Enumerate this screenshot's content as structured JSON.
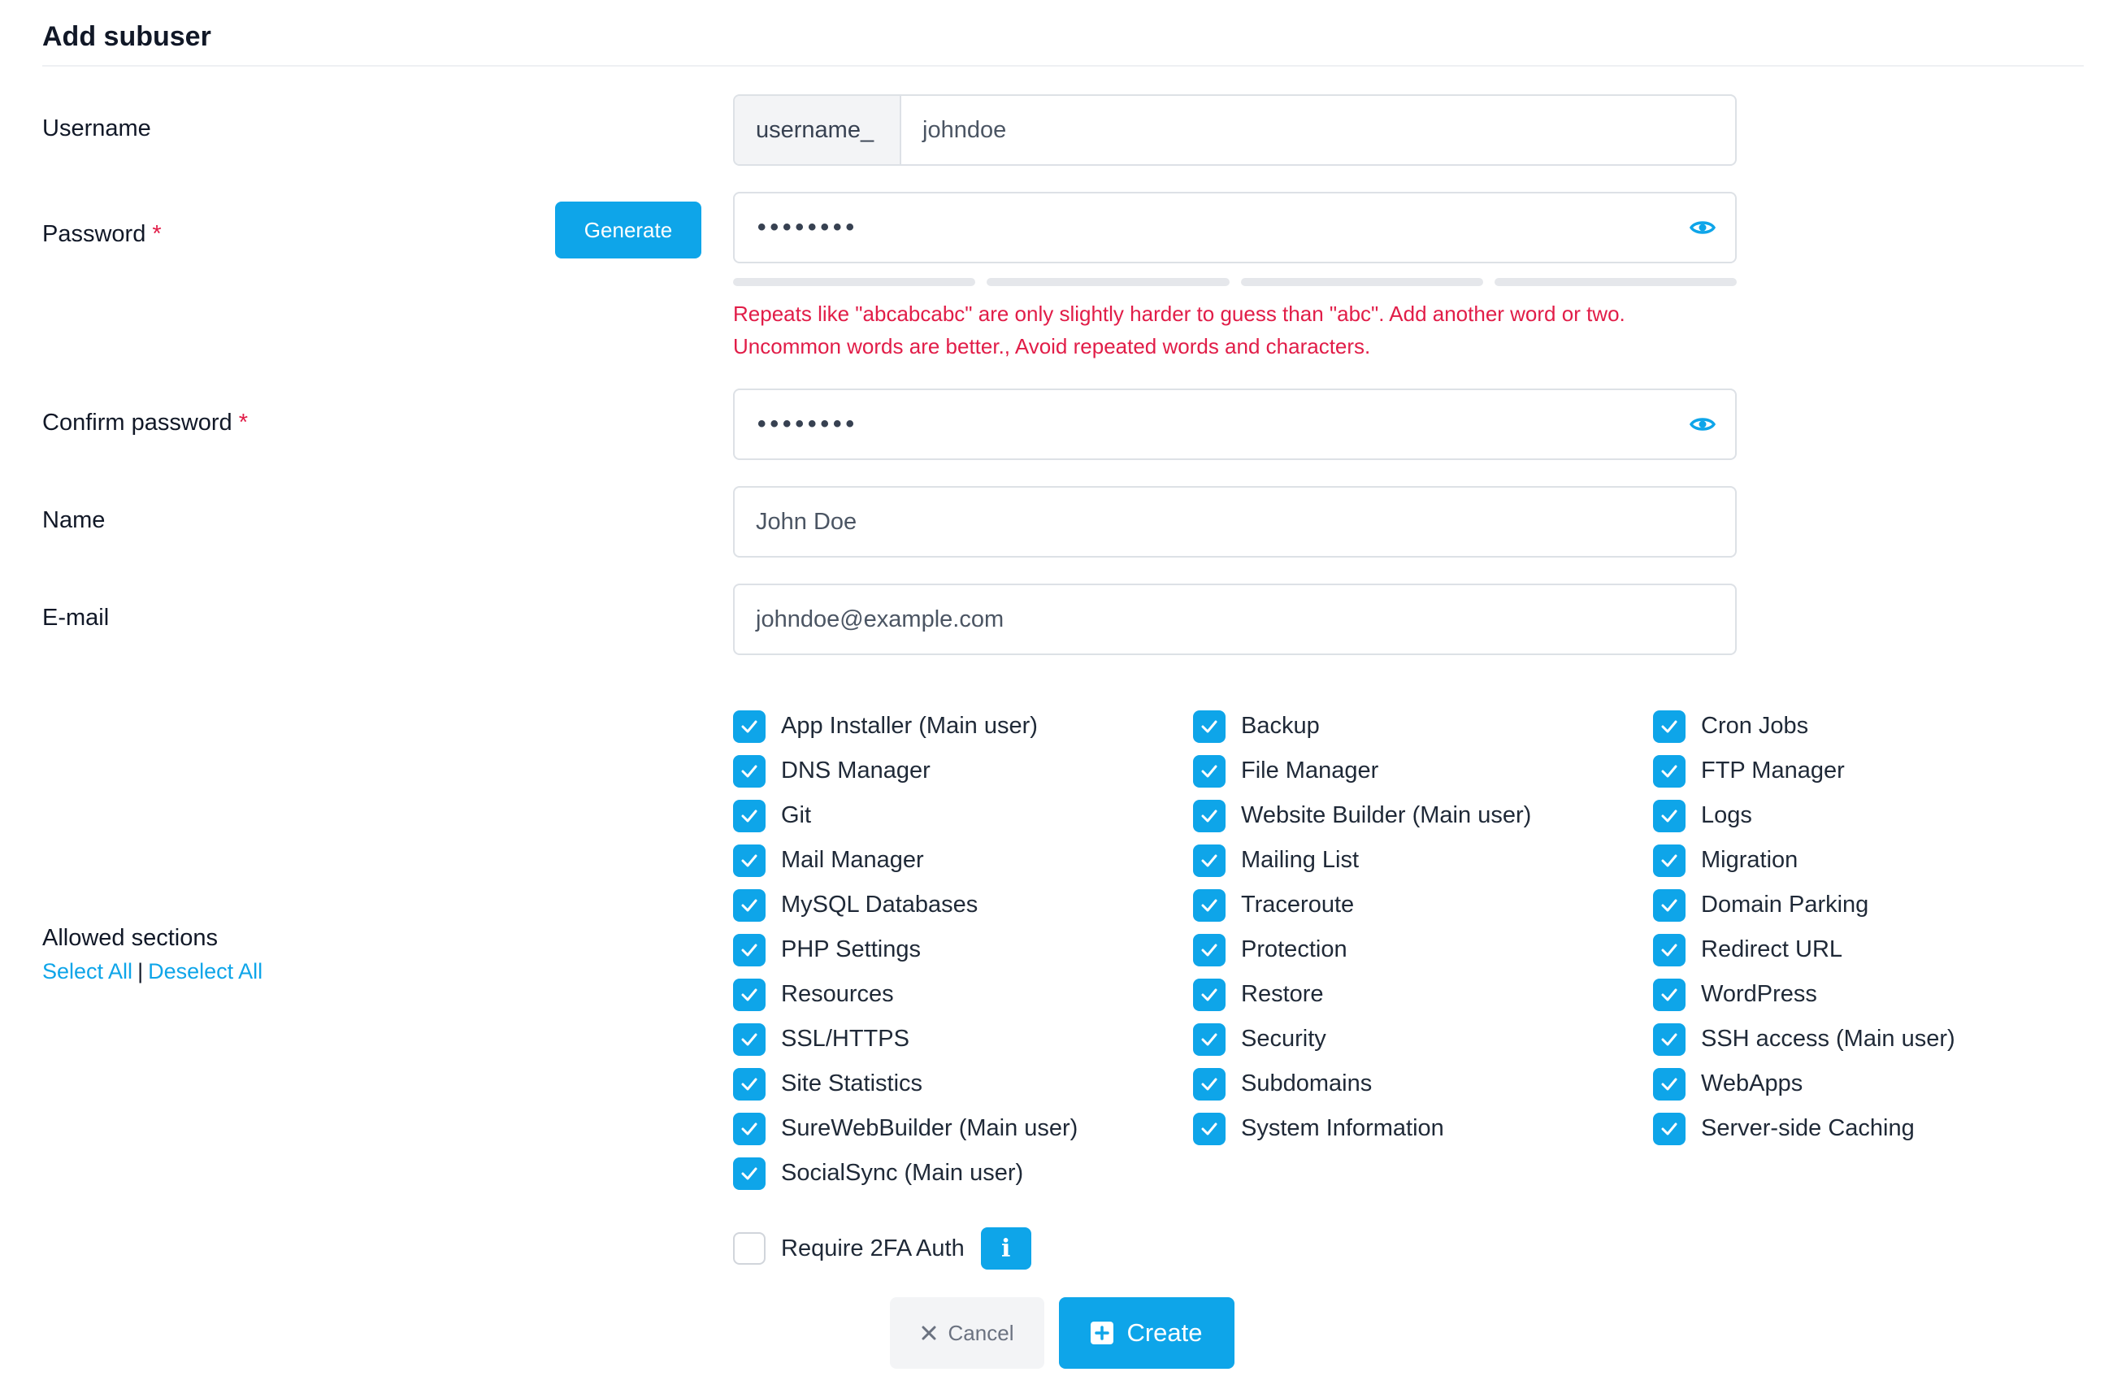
{
  "page": {
    "title": "Add subuser"
  },
  "form": {
    "username": {
      "label": "Username",
      "prefix": "username_",
      "value": "johndoe"
    },
    "password": {
      "label": "Password",
      "required_mark": "*",
      "value": "••••••••",
      "generate_label": "Generate"
    },
    "password_feedback": {
      "line1": "Repeats like \"abcabcabc\" are only slightly harder to guess than \"abc\". Add another word or two.",
      "line2": "Uncommon words are better., Avoid repeated words and characters."
    },
    "confirm_password": {
      "label": "Confirm password",
      "required_mark": "*",
      "value": "••••••••"
    },
    "name": {
      "label": "Name",
      "value": "John Doe"
    },
    "email": {
      "label": "E-mail",
      "value": "johndoe@example.com"
    }
  },
  "allowed_sections": {
    "label": "Allowed sections",
    "select_all": "Select All",
    "separator": "|",
    "deselect_all": "Deselect All",
    "columns": [
      [
        {
          "label": "App Installer (Main user)",
          "checked": true
        },
        {
          "label": "DNS Manager",
          "checked": true
        },
        {
          "label": "Git",
          "checked": true
        },
        {
          "label": "Mail Manager",
          "checked": true
        },
        {
          "label": "MySQL Databases",
          "checked": true
        },
        {
          "label": "PHP Settings",
          "checked": true
        },
        {
          "label": "Resources",
          "checked": true
        },
        {
          "label": "SSL/HTTPS",
          "checked": true
        },
        {
          "label": "Site Statistics",
          "checked": true
        },
        {
          "label": "SureWebBuilder (Main user)",
          "checked": true
        },
        {
          "label": "SocialSync (Main user)",
          "checked": true
        }
      ],
      [
        {
          "label": "Backup",
          "checked": true
        },
        {
          "label": "File Manager",
          "checked": true
        },
        {
          "label": "Website Builder (Main user)",
          "checked": true
        },
        {
          "label": "Mailing List",
          "checked": true
        },
        {
          "label": "Traceroute",
          "checked": true
        },
        {
          "label": "Protection",
          "checked": true
        },
        {
          "label": "Restore",
          "checked": true
        },
        {
          "label": "Security",
          "checked": true
        },
        {
          "label": "Subdomains",
          "checked": true
        },
        {
          "label": "System Information",
          "checked": true
        }
      ],
      [
        {
          "label": "Cron Jobs",
          "checked": true
        },
        {
          "label": "FTP Manager",
          "checked": true
        },
        {
          "label": "Logs",
          "checked": true
        },
        {
          "label": "Migration",
          "checked": true
        },
        {
          "label": "Domain Parking",
          "checked": true
        },
        {
          "label": "Redirect URL",
          "checked": true
        },
        {
          "label": "WordPress",
          "checked": true
        },
        {
          "label": "SSH access (Main user)",
          "checked": true
        },
        {
          "label": "WebApps",
          "checked": true
        },
        {
          "label": "Server-side Caching",
          "checked": true
        }
      ]
    ]
  },
  "two_factor": {
    "label": "Require 2FA Auth",
    "checked": false,
    "info_icon": "info-icon"
  },
  "actions": {
    "cancel_label": "Cancel",
    "create_label": "Create"
  },
  "colors": {
    "accent": "#0ea5e9",
    "error": "#e11d48",
    "border": "#dde1e6"
  }
}
